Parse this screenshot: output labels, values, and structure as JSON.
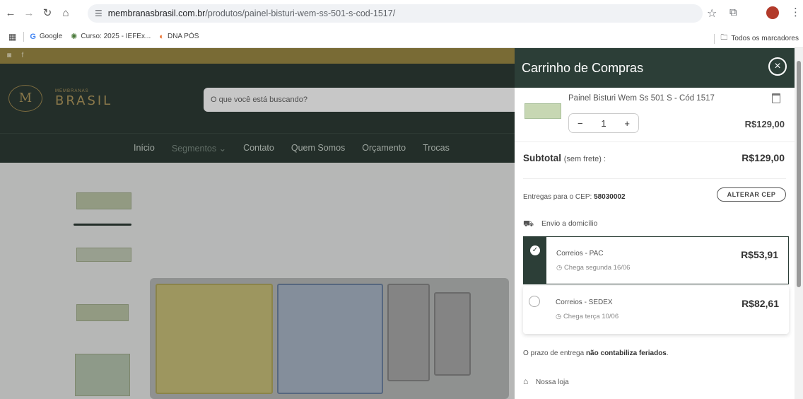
{
  "browser": {
    "url_host": "membranasbrasil.com.br",
    "url_path": "/produtos/painel-bisturi-wem-ss-501-s-cod-1517/",
    "bookmarks": [
      {
        "label": "Google",
        "icon": "google-g-icon"
      },
      {
        "label": "Curso: 2025 - IEFEx...",
        "icon": "globe-icon"
      },
      {
        "label": "DNA PÓS",
        "icon": "dna-icon"
      }
    ],
    "all_bookmarks_label": "Todos os marcadores"
  },
  "site": {
    "logo_small": "MEMBRANAS",
    "logo_big": "BRASIL",
    "search_placeholder": "O que você está buscando?",
    "nav": [
      "Início",
      "Segmentos ⌄",
      "Contato",
      "Quem Somos",
      "Orçamento",
      "Trocas"
    ]
  },
  "cart": {
    "title": "Carrinho de Compras",
    "item": {
      "name": "Painel Bisturi Wem Ss 501 S - Cód 1517",
      "quantity": "1",
      "price": "R$129,00"
    },
    "subtotal_label": "Subtotal",
    "subtotal_note": "(sem frete) :",
    "subtotal_value": "R$129,00",
    "cep_prefix": "Entregas para o CEP:",
    "cep_value": "58030002",
    "change_cep_label": "ALTERAR CEP",
    "home_delivery_label": "Envio a domicílio",
    "shipping": [
      {
        "name": "Correios - PAC",
        "eta": "Chega segunda 16/06",
        "price": "R$53,91",
        "selected": true
      },
      {
        "name": "Correios - SEDEX",
        "eta": "Chega terça 10/06",
        "price": "R$82,61",
        "selected": false
      }
    ],
    "prazo_text": "O prazo de entrega",
    "prazo_bold": "não contabiliza feriados",
    "store_label": "Nossa loja"
  },
  "colors": {
    "drawer_header": "#2c3e37",
    "site_header": "#2e3b35",
    "gold": "#b19a5f"
  }
}
